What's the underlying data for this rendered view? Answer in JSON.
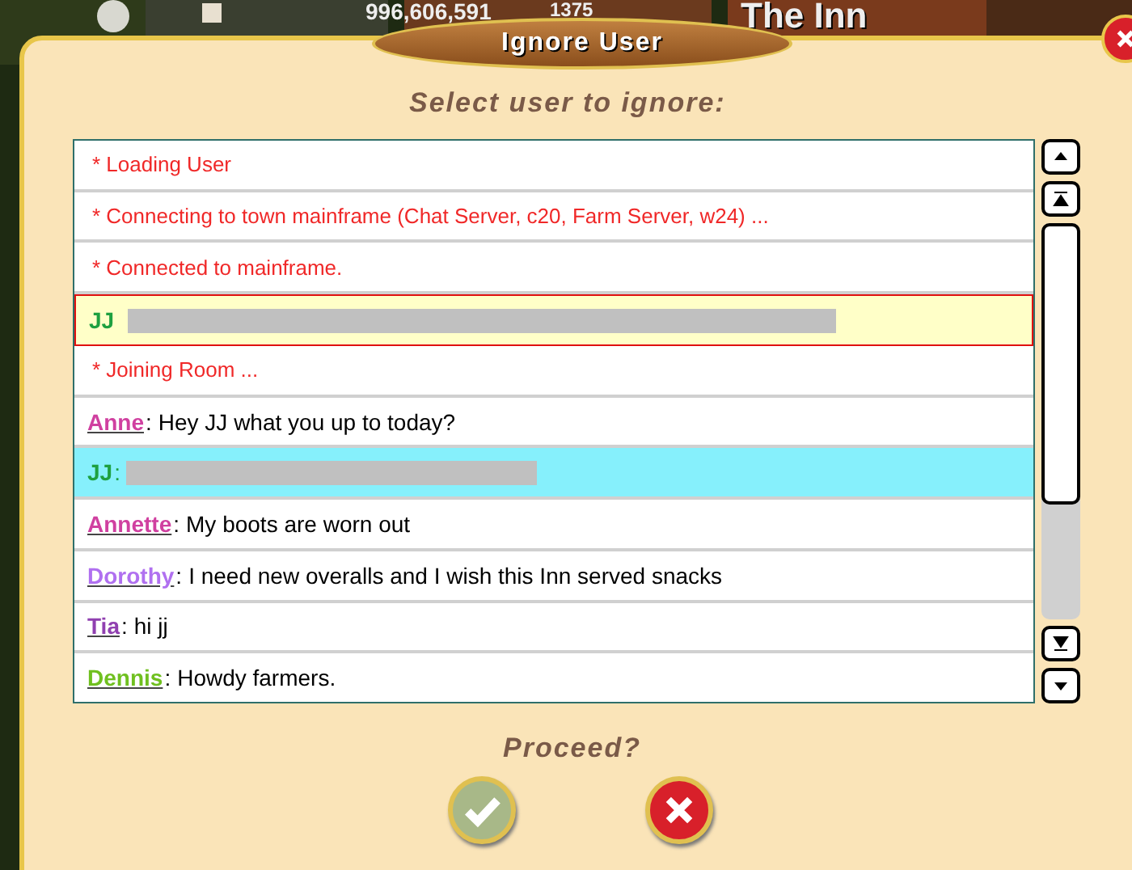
{
  "background": {
    "coins": "996,606,591",
    "count": "1375",
    "location": "The Inn"
  },
  "dialog": {
    "title": "Ignore User",
    "prompt": "Select user to ignore:"
  },
  "messages": [
    {
      "kind": "system",
      "text": "* Loading User",
      "selected": false,
      "highlighted": false
    },
    {
      "kind": "system",
      "text": "* Connecting to town mainframe (Chat Server, c20, Farm Server, w24) ...",
      "selected": false,
      "highlighted": false
    },
    {
      "kind": "system",
      "text": "* Connected to mainframe.",
      "selected": false,
      "highlighted": false
    },
    {
      "kind": "chat",
      "name": "JJ",
      "color": "#1ea040",
      "redacted": true,
      "underlined": false,
      "selected": false,
      "highlighted": true
    },
    {
      "kind": "system",
      "text": "* Joining Room ...",
      "selected": false,
      "highlighted": false
    },
    {
      "kind": "chat",
      "name": "Anne",
      "color": "#d040a0",
      "separator": ":",
      "text": "Hey JJ what you up to today?",
      "redacted": false,
      "underlined": true,
      "selected": false,
      "highlighted": false
    },
    {
      "kind": "chat",
      "name": "JJ",
      "color": "#1ea040",
      "separator": ":",
      "redacted": true,
      "underlined": false,
      "selected": true,
      "highlighted": false
    },
    {
      "kind": "chat",
      "name": "Annette",
      "color": "#d040a0",
      "separator": ":",
      "text": "My boots are worn out",
      "redacted": false,
      "underlined": true,
      "selected": false,
      "highlighted": false
    },
    {
      "kind": "chat",
      "name": "Dorothy",
      "color": "#b070f0",
      "separator": ":",
      "text": "I need new overalls and I wish this Inn served snacks",
      "redacted": false,
      "underlined": true,
      "selected": false,
      "highlighted": false
    },
    {
      "kind": "chat",
      "name": "Tia",
      "color": "#9040b0",
      "separator": ":",
      "text": "hi jj",
      "redacted": false,
      "underlined": true,
      "selected": false,
      "highlighted": false
    },
    {
      "kind": "chat",
      "name": "Dennis",
      "color": "#70c020",
      "separator": ":",
      "text": "Howdy farmers.",
      "redacted": false,
      "underlined": true,
      "selected": false,
      "highlighted": false
    }
  ],
  "footer": {
    "question": "Proceed?"
  }
}
